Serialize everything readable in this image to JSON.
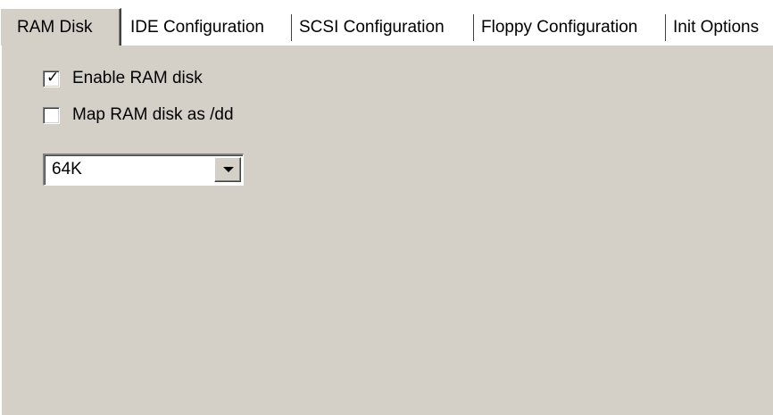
{
  "tabs": [
    {
      "label": "RAM Disk",
      "active": true
    },
    {
      "label": "IDE Configuration",
      "active": false
    },
    {
      "label": "SCSI Configuration",
      "active": false
    },
    {
      "label": "Floppy Configuration",
      "active": false
    },
    {
      "label": "Init Options",
      "active": false
    }
  ],
  "ram_disk": {
    "enable_label": "Enable RAM disk",
    "enable_checked": true,
    "check_mark": "✓",
    "map_label": "Map RAM disk as /dd",
    "map_checked": false,
    "size_value": "64K"
  },
  "icons": {
    "checkbox_mark": "check-mark-icon",
    "dropdown": "chevron-down-icon"
  },
  "colors": {
    "face": "#d4d0c8",
    "highlight": "#ffffff",
    "shadow": "#808080",
    "dark_shadow": "#404040"
  }
}
